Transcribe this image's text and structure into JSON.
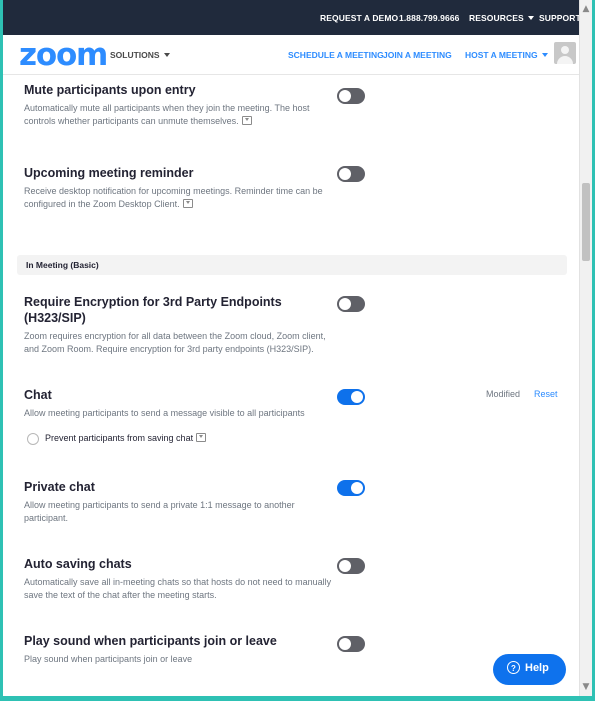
{
  "topbar": {
    "request_demo": "REQUEST A DEMO",
    "phone": "1.888.799.9666",
    "resources": "RESOURCES",
    "support": "SUPPORT"
  },
  "navbar": {
    "logo": "zoom",
    "solutions": "SOLUTIONS",
    "schedule": "SCHEDULE A MEETING",
    "join": "JOIN A MEETING",
    "host": "HOST A MEETING"
  },
  "settings": {
    "mute": {
      "title": "Mute participants upon entry",
      "desc": "Automatically mute all participants when they join the meeting. The host controls whether participants can unmute themselves.",
      "enabled": false
    },
    "reminder": {
      "title": "Upcoming meeting reminder",
      "desc": "Receive desktop notification for upcoming meetings. Reminder time can be configured in the Zoom Desktop Client.",
      "enabled": false
    },
    "section_title": "In Meeting (Basic)",
    "encryption": {
      "title": "Require Encryption for 3rd Party Endpoints (H323/SIP)",
      "desc": "Zoom requires encryption for all data between the Zoom cloud, Zoom client, and Zoom Room. Require encryption for 3rd party endpoints (H323/SIP).",
      "enabled": false
    },
    "chat": {
      "title": "Chat",
      "desc": "Allow meeting participants to send a message visible to all participants",
      "enabled": true,
      "modified": "Modified",
      "reset": "Reset",
      "sub_option": "Prevent participants from saving chat",
      "sub_checked": false
    },
    "private_chat": {
      "title": "Private chat",
      "desc": "Allow meeting participants to send a private 1:1 message to another participant.",
      "enabled": true
    },
    "auto_save": {
      "title": "Auto saving chats",
      "desc": "Automatically save all in-meeting chats so that hosts do not need to manually save the text of the chat after the meeting starts.",
      "enabled": false
    },
    "join_sound": {
      "title": "Play sound when participants join or leave",
      "desc": "Play sound when participants join or leave",
      "enabled": false
    }
  },
  "help": {
    "label": "Help",
    "icon": "?"
  },
  "colors": {
    "brand_blue": "#2d8cff",
    "toggle_on": "#0e71eb",
    "toggle_off": "#5f6067",
    "topbar_bg": "#202a3c",
    "frame": "#2ec1b4"
  },
  "icons": [
    "info-icon",
    "chevron-down-icon",
    "avatar-icon",
    "help-icon",
    "scroll-up-icon",
    "scroll-down-icon"
  ]
}
